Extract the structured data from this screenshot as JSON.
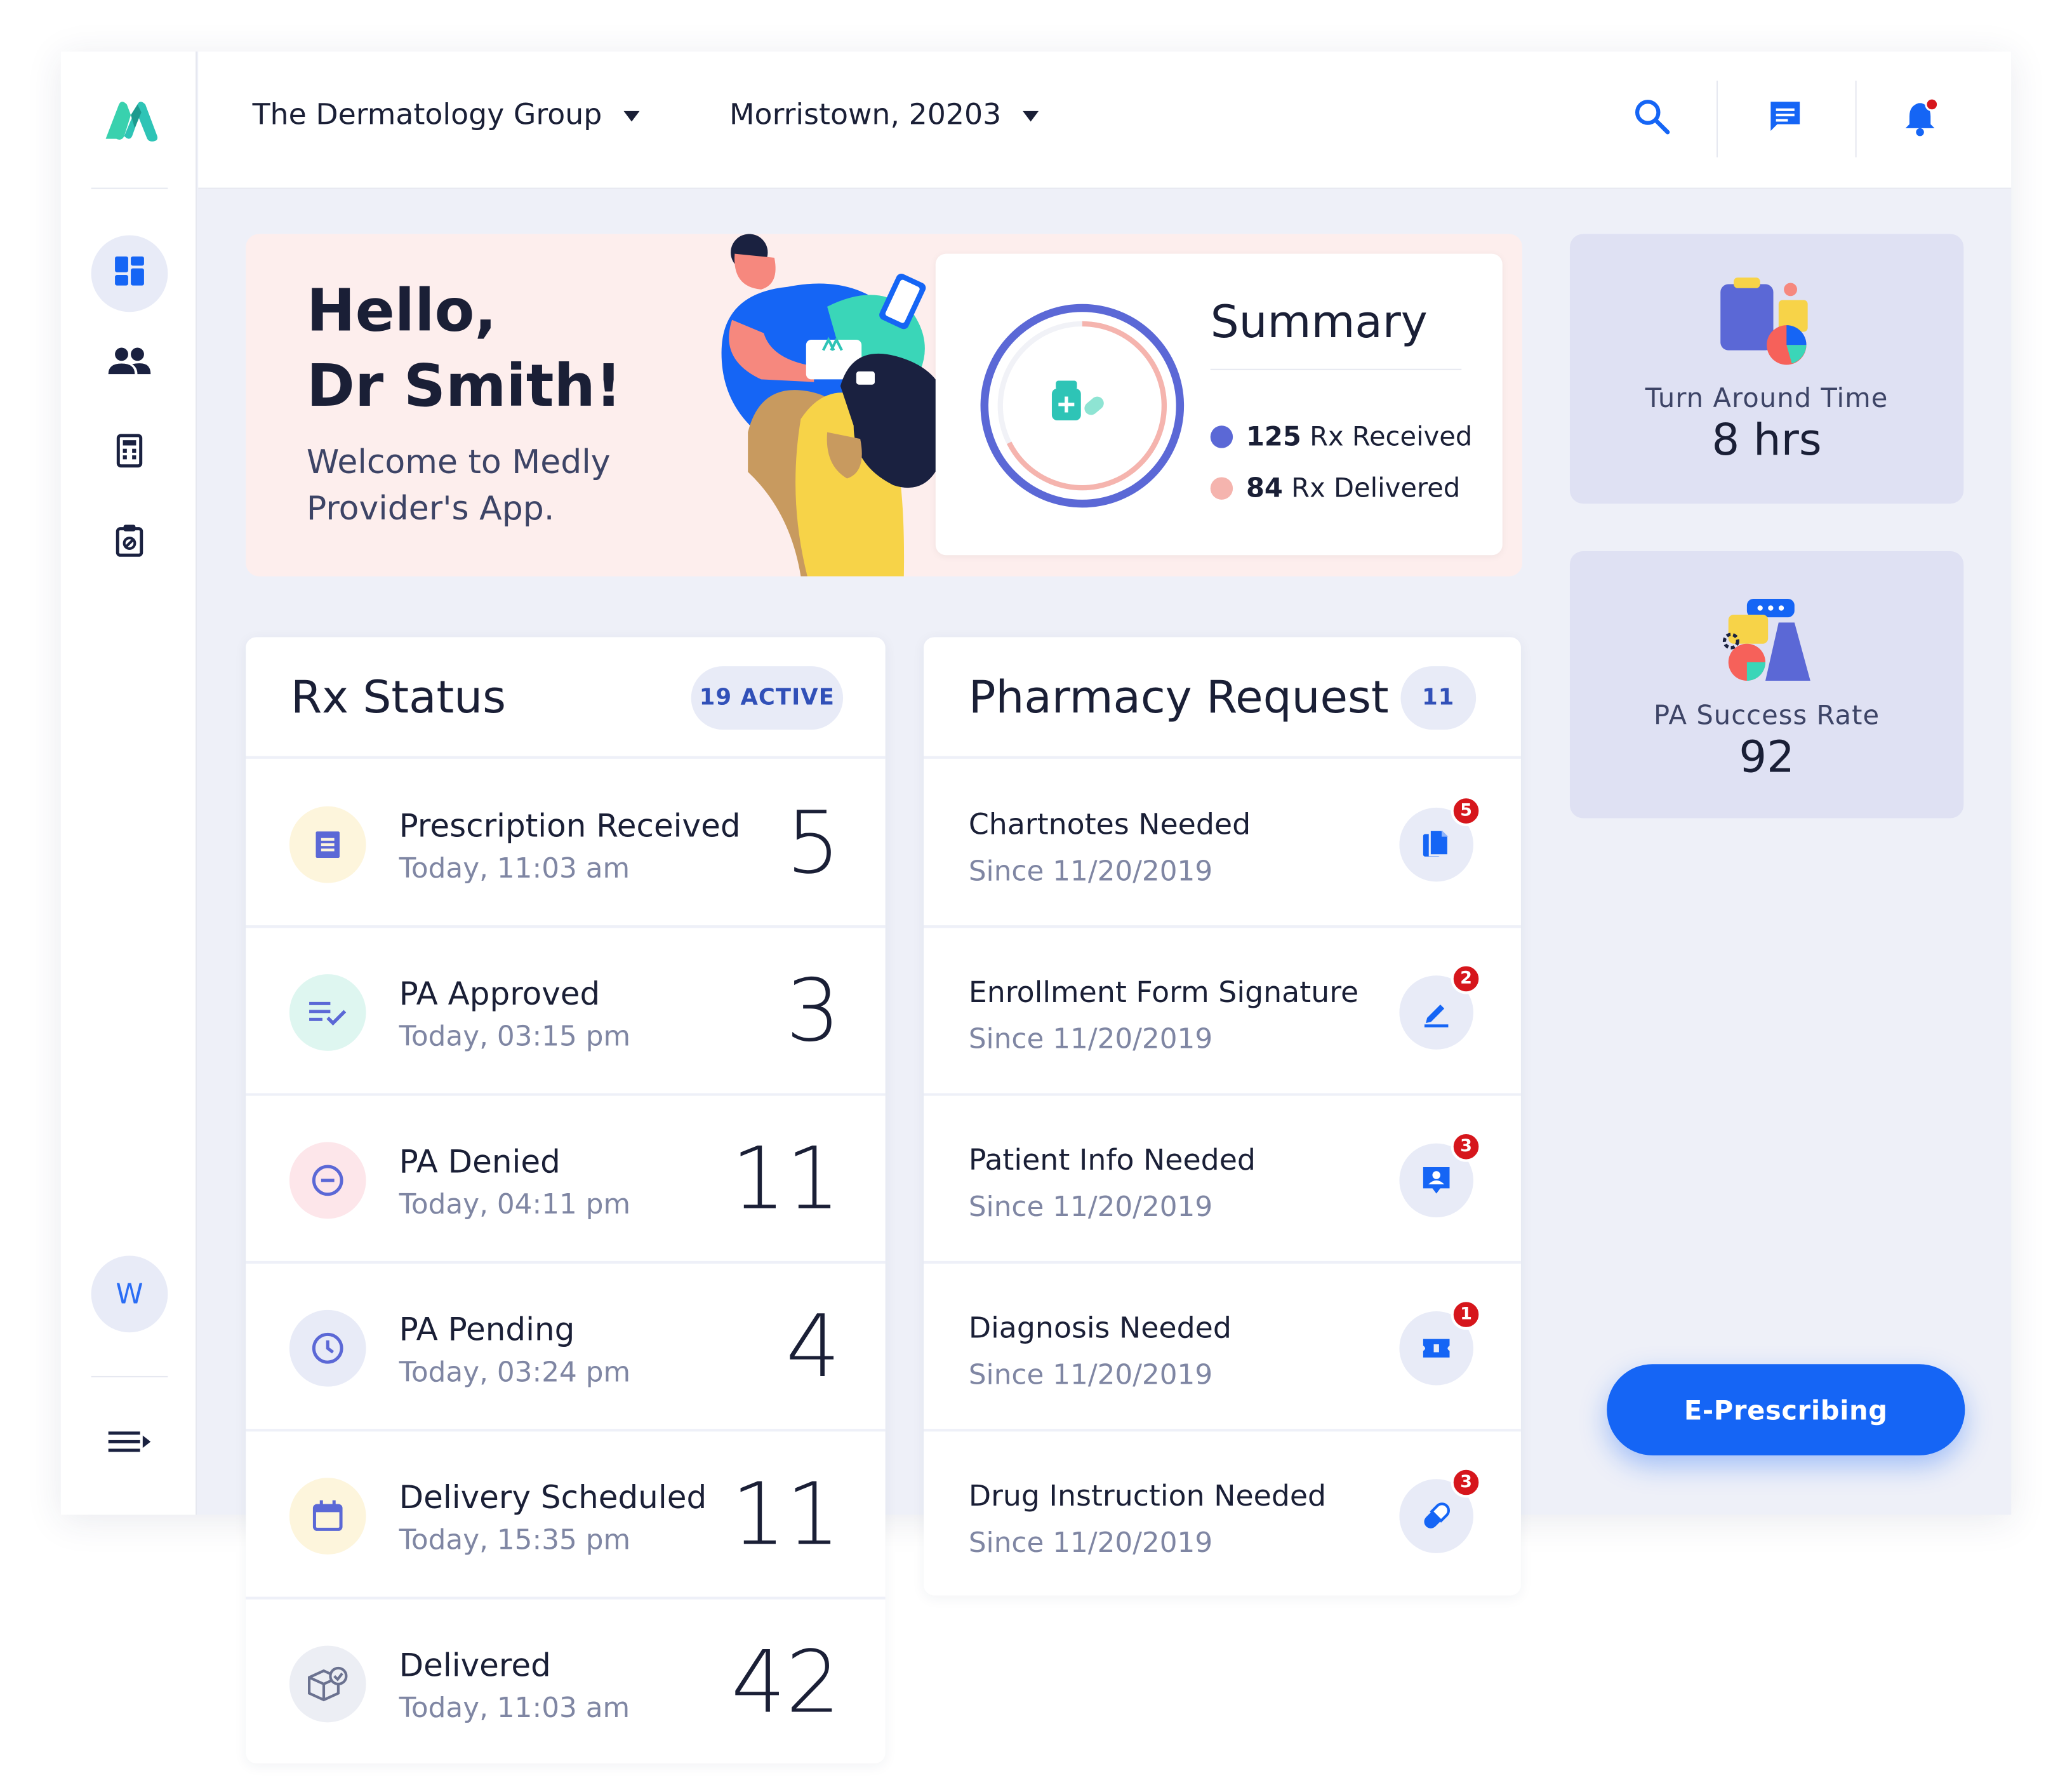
{
  "header": {
    "practice": "The Dermatology Group",
    "location": "Morristown, 20203"
  },
  "sidebar": {
    "items": [
      {
        "icon": "dashboard-icon",
        "active": true
      },
      {
        "icon": "people-icon",
        "active": false
      },
      {
        "icon": "calculator-icon",
        "active": false
      },
      {
        "icon": "clipboard-icon",
        "active": false
      }
    ],
    "avatar_initial": "W",
    "menu_icon": "menu-collapse-icon"
  },
  "hero": {
    "greeting_line1": "Hello,",
    "greeting_line2": "Dr Smith!",
    "welcome_line1": "Welcome to Medly",
    "welcome_line2": "Provider's App."
  },
  "summary": {
    "title": "Summary",
    "received_count": "125",
    "received_label": "Rx Received",
    "delivered_count": "84",
    "delivered_label": "Rx Delivered",
    "received_color": "#5b68d6",
    "delivered_color": "#f5b4ae"
  },
  "stats": {
    "turnaround_label": "Turn Around Time",
    "turnaround_value": "8 hrs",
    "pa_label": "PA Success Rate",
    "pa_value": "92"
  },
  "rx_status": {
    "title": "Rx Status",
    "active_label": "19 ACTIVE",
    "rows": [
      {
        "title": "Prescription Received",
        "time": "Today, 11:03 am",
        "count": "5",
        "icon": "receipt-icon",
        "bg": "#fdf5dc"
      },
      {
        "title": "PA Approved",
        "time": "Today, 03:15 pm",
        "count": "3",
        "icon": "list-check-icon",
        "bg": "#def6f0"
      },
      {
        "title": "PA Denied",
        "time": "Today, 04:11 pm",
        "count": "11",
        "icon": "minus-circle-icon",
        "bg": "#fde6ea"
      },
      {
        "title": "PA Pending",
        "time": "Today, 03:24 pm",
        "count": "4",
        "icon": "clock-icon",
        "bg": "#e8ebf7"
      },
      {
        "title": "Delivery Scheduled",
        "time": "Today, 15:35 pm",
        "count": "11",
        "icon": "calendar-icon",
        "bg": "#fdf5dc"
      },
      {
        "title": "Delivered",
        "time": "Today, 11:03 am",
        "count": "42",
        "icon": "package-check-icon",
        "bg": "#eceef4"
      }
    ]
  },
  "pharmacy": {
    "title": "Pharmacy Request",
    "count": "11",
    "rows": [
      {
        "title": "Chartnotes Needed",
        "since": "Since 11/20/2019",
        "badge": "5",
        "icon": "documents-icon"
      },
      {
        "title": "Enrollment Form Signature",
        "since": "Since 11/20/2019",
        "badge": "2",
        "icon": "pen-icon"
      },
      {
        "title": "Patient Info Needed",
        "since": "Since 11/20/2019",
        "badge": "3",
        "icon": "contact-icon"
      },
      {
        "title": "Diagnosis Needed",
        "since": "Since 11/20/2019",
        "badge": "1",
        "icon": "ticket-icon"
      },
      {
        "title": "Drug Instruction Needed",
        "since": "Since 11/20/2019",
        "badge": "3",
        "icon": "pill-icon"
      }
    ]
  },
  "cta": {
    "label": "E-Prescribing"
  },
  "colors": {
    "accent": "#1565f5",
    "badge": "#d6161c",
    "background": "#eef0f8"
  }
}
